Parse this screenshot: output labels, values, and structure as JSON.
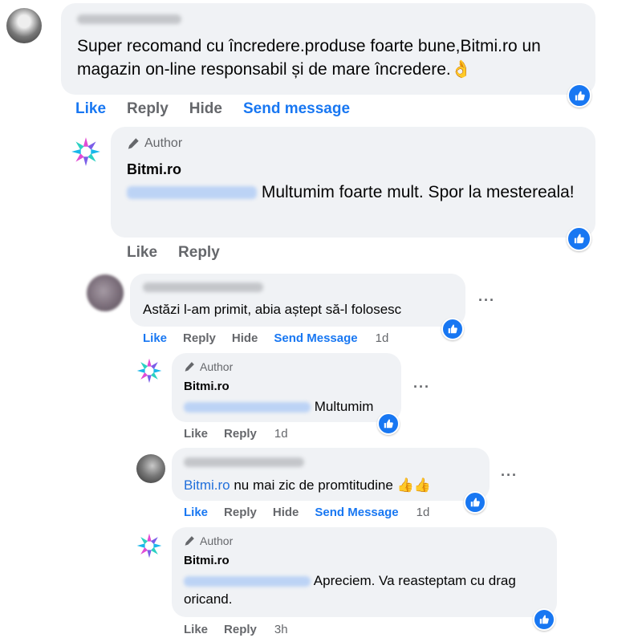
{
  "comments": [
    {
      "id": "c1",
      "text": "Super recomand cu încredere.produse foarte bune,Bitmi.ro un magazin on-line responsabil și de mare încredere.",
      "emoji": "👌",
      "actions": [
        "Like",
        "Reply",
        "Hide",
        "Send message"
      ]
    },
    {
      "id": "r1",
      "author_tag": "Author",
      "name": "Bitmi.ro",
      "text": "Multumim foarte mult. Spor la mestereala!",
      "actions": [
        "Like",
        "Reply"
      ]
    },
    {
      "id": "c2",
      "text": "Astăzi l-am primit, abia aștept să-l folosesc",
      "actions": [
        "Like",
        "Reply",
        "Hide",
        "Send Message"
      ],
      "time": "1d",
      "menu": "···"
    },
    {
      "id": "r2",
      "author_tag": "Author",
      "name": "Bitmi.ro",
      "text": "Multumim",
      "actions": [
        "Like",
        "Reply"
      ],
      "time": "1d",
      "menu": "···"
    },
    {
      "id": "c3",
      "link_text": "Bitmi.ro",
      "text": " nu mai zic de promtitudine",
      "emoji": "👍👍",
      "actions": [
        "Like",
        "Reply",
        "Hide",
        "Send Message"
      ],
      "time": "1d",
      "menu": "···"
    },
    {
      "id": "r3",
      "author_tag": "Author",
      "name": "Bitmi.ro",
      "text": "Apreciem. Va reasteptam cu drag oricand.",
      "actions": [
        "Like",
        "Reply"
      ],
      "time": "3h"
    }
  ],
  "colors": {
    "accent": "#1877f2",
    "bubble": "#f0f2f5",
    "secondary_text": "#65676b",
    "link": "#216fdb"
  },
  "icons": {
    "like": "thumbs-up-icon",
    "author": "pencil-icon",
    "logo": "bitmi-star-logo"
  }
}
